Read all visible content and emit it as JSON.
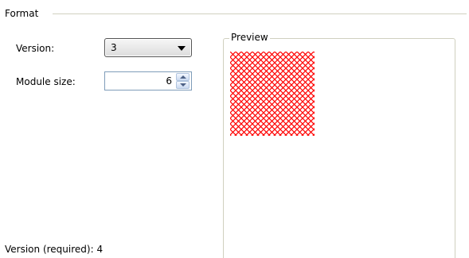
{
  "format_group": {
    "title": "Format"
  },
  "version": {
    "label": "Version:",
    "selected": "3"
  },
  "module_size": {
    "label": "Module size:",
    "value": "6"
  },
  "preview": {
    "title": "Preview",
    "pattern_color": "#ff0000"
  },
  "status": {
    "required_version_text": "Version (required): 4"
  },
  "icons": {
    "dropdown": "chevron-down-icon",
    "spin_up": "spin-up-icon",
    "spin_down": "spin-down-icon"
  }
}
